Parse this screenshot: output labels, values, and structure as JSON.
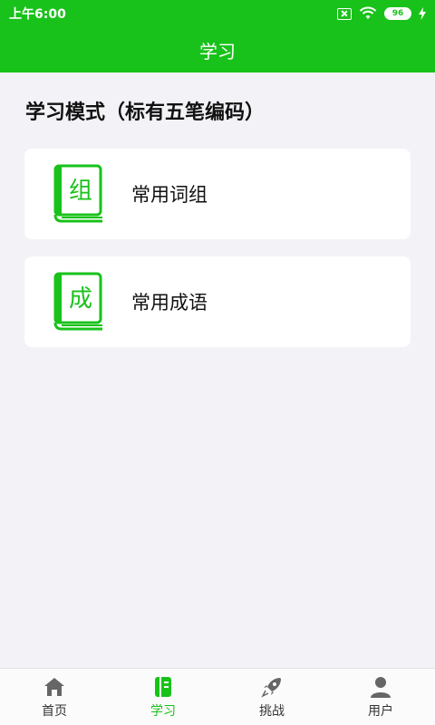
{
  "status_bar": {
    "time": "上午6:00",
    "battery": "96"
  },
  "header": {
    "title": "学习"
  },
  "section": {
    "title": "学习模式（标有五笔编码）"
  },
  "cards": [
    {
      "glyph": "组",
      "label": "常用词组"
    },
    {
      "glyph": "成",
      "label": "常用成语"
    }
  ],
  "tabs": [
    {
      "label": "首页",
      "icon": "home-icon"
    },
    {
      "label": "学习",
      "icon": "book-icon"
    },
    {
      "label": "挑战",
      "icon": "rocket-icon"
    },
    {
      "label": "用户",
      "icon": "user-icon"
    }
  ],
  "colors": {
    "accent": "#19c21a",
    "background": "#f3f2f6",
    "inactive_icon": "#666666"
  }
}
